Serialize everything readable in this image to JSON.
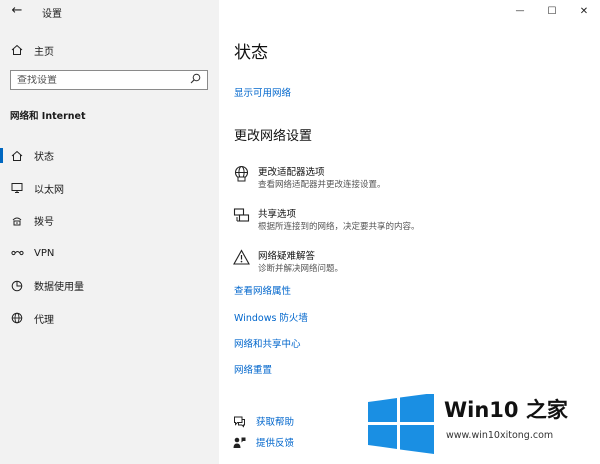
{
  "window": {
    "app_title": "设置",
    "controls": {
      "minimize_icon": "—",
      "maximize_icon": "☐",
      "close_icon": "✕"
    }
  },
  "sidebar": {
    "back_icon": "←",
    "home_label": "主页",
    "search": {
      "placeholder": "查找设置"
    },
    "section_title": "网络和 Internet",
    "items": [
      {
        "label": "状态",
        "icon": "home-status-icon",
        "active": true
      },
      {
        "label": "以太网",
        "icon": "ethernet-icon"
      },
      {
        "label": "拨号",
        "icon": "dialup-icon"
      },
      {
        "label": "VPN",
        "icon": "vpn-icon"
      },
      {
        "label": "数据使用量",
        "icon": "data-usage-icon"
      },
      {
        "label": "代理",
        "icon": "globe-icon"
      }
    ]
  },
  "main": {
    "page_title": "状态",
    "show_networks_link": "显示可用网络",
    "change_settings_heading": "更改网络设置",
    "options": [
      {
        "title": "更改适配器选项",
        "desc": "查看网络适配器并更改连接设置。",
        "icon": "adapter-icon"
      },
      {
        "title": "共享选项",
        "desc": "根据所连接到的网络，决定要共享的内容。",
        "icon": "sharing-icon"
      },
      {
        "title": "网络疑难解答",
        "desc": "诊断并解决网络问题。",
        "icon": "warning-icon"
      }
    ],
    "links": [
      "查看网络属性",
      "Windows 防火墙",
      "网络和共享中心",
      "网络重置"
    ],
    "help": [
      {
        "label": "获取帮助",
        "icon": "help-chat-icon"
      },
      {
        "label": "提供反馈",
        "icon": "feedback-icon"
      }
    ]
  },
  "watermark": {
    "name": "Win10 之家",
    "url": "www.win10xitong.com",
    "colors": {
      "logo_blue": "#1a8fe3"
    }
  },
  "colors": {
    "accent": "#0067c0",
    "link": "#0066cc",
    "sidebar_bg": "#f2f2f2"
  }
}
